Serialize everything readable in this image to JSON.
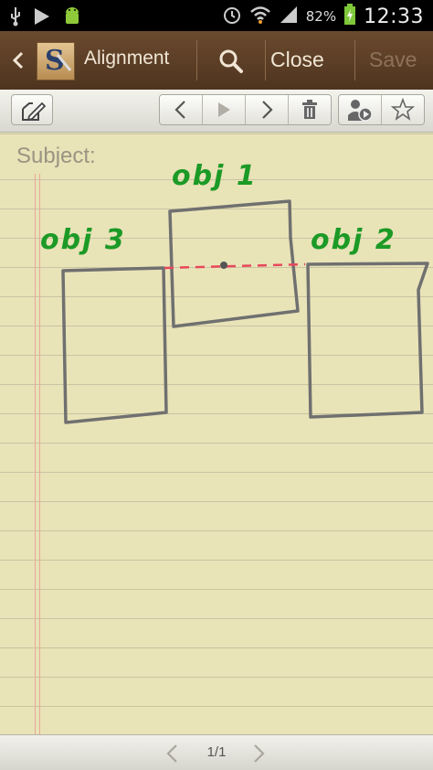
{
  "status_bar": {
    "battery_percent": "82%",
    "time": "12:33"
  },
  "action_bar": {
    "app_logo_letter": "S",
    "title": "Alignment",
    "close_label": "Close",
    "save_label": "Save"
  },
  "note": {
    "subject_placeholder": "Subject:",
    "objects": [
      {
        "label": "obj 1"
      },
      {
        "label": "obj 2"
      },
      {
        "label": "obj 3"
      }
    ]
  },
  "pager": {
    "page_indicator": "1/1"
  },
  "colors": {
    "ink_green": "#1c9a26",
    "box_gray": "#707070",
    "guide_red": "#e8485a"
  }
}
